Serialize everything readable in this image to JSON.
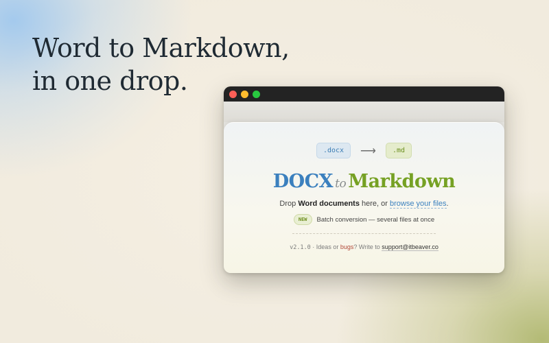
{
  "hero": {
    "line1": "Word to Markdown,",
    "line2": "in one drop."
  },
  "window": {
    "badges": {
      "from": ".docx",
      "arrow": "⟶",
      "to": ".md"
    },
    "brand": {
      "docx": "DOCX",
      "to": "to",
      "markdown": "Markdown"
    },
    "drop": {
      "prefix": "Drop ",
      "bold": "Word documents",
      "middle": " here, or ",
      "link": "browse your files",
      "suffix": "."
    },
    "new_badge": "NEW",
    "new_text": "Batch conversion — several files at once",
    "footer": {
      "version": "v2.1.0",
      "sep": " · ",
      "ideas": "Ideas or ",
      "bugs": "bugs",
      "write": "? Write to ",
      "email": "support@itbeaver.co"
    }
  },
  "colors": {
    "docx_blue": "#3b80be",
    "md_green": "#76a124",
    "bugs_red": "#b24a3a"
  }
}
